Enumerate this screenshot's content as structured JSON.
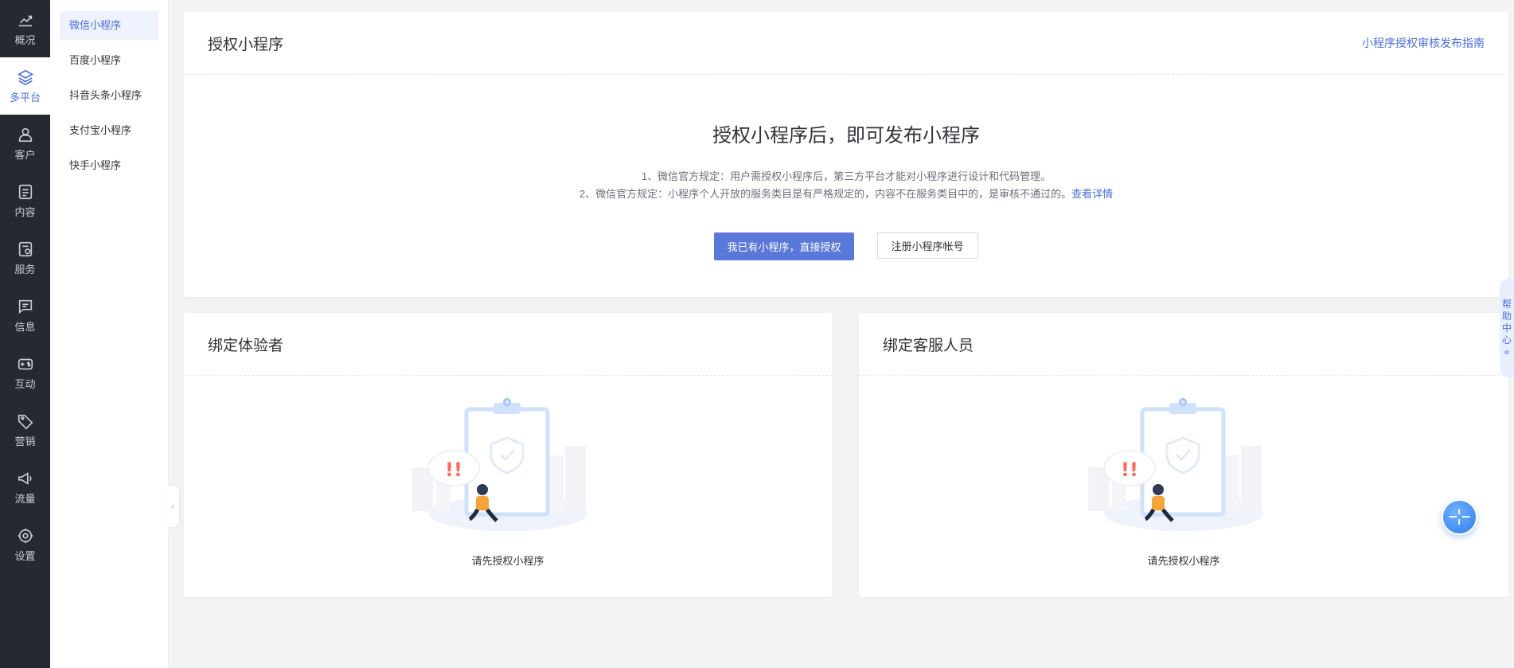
{
  "nav": {
    "items": [
      {
        "label": "概况",
        "icon": "chart-up-icon"
      },
      {
        "label": "多平台",
        "icon": "layers-icon"
      },
      {
        "label": "客户",
        "icon": "user-icon"
      },
      {
        "label": "内容",
        "icon": "document-icon"
      },
      {
        "label": "服务",
        "icon": "service-icon"
      },
      {
        "label": "信息",
        "icon": "message-icon"
      },
      {
        "label": "互动",
        "icon": "gamepad-icon"
      },
      {
        "label": "营销",
        "icon": "tag-icon"
      },
      {
        "label": "流量",
        "icon": "megaphone-icon"
      },
      {
        "label": "设置",
        "icon": "gear-icon"
      }
    ],
    "active_index": 1
  },
  "subnav": {
    "items": [
      "微信小程序",
      "百度小程序",
      "抖音头条小程序",
      "支付宝小程序",
      "快手小程序"
    ],
    "active_index": 0
  },
  "auth_card": {
    "title": "授权小程序",
    "guide_link": "小程序授权审核发布指南",
    "heading": "授权小程序后，即可发布小程序",
    "rule1": "1、微信官方规定：用户需授权小程序后，第三方平台才能对小程序进行设计和代码管理。",
    "rule2": "2、微信官方规定：小程序个人开放的服务类目是有严格规定的，内容不在服务类目中的，是审核不通过的。",
    "rule2_link": "查看详情",
    "primary_button": "我已有小程序，直接授权",
    "secondary_button": "注册小程序帐号"
  },
  "tester_card": {
    "title": "绑定体验者",
    "empty_text": "请先授权小程序"
  },
  "cs_card": {
    "title": "绑定客服人员",
    "empty_text": "请先授权小程序"
  },
  "help_tab": {
    "chars": [
      "帮",
      "助",
      "中",
      "心"
    ],
    "arrow": "«"
  },
  "colors": {
    "accent": "#4a6ee0",
    "primary_button": "#5a77da",
    "nav_bg": "#26292f"
  }
}
